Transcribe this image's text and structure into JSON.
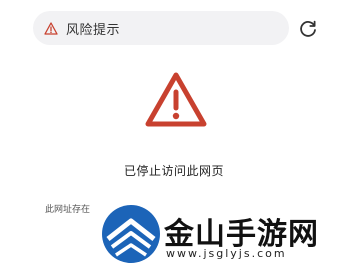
{
  "address_bar": {
    "title": "风险提示",
    "warning_icon": "warning-triangle-icon",
    "reload_icon": "reload-icon"
  },
  "main": {
    "warning_icon": "warning-triangle-icon",
    "message": "已停止访问此网页",
    "detail": "此网址存在"
  },
  "watermark": {
    "name": "金山手游网",
    "url": "www.jsglyjs.com"
  },
  "colors": {
    "warning": "#c8412f",
    "address_bar_bg": "#f2f2f4",
    "watermark_blue": "#1c64b8"
  }
}
